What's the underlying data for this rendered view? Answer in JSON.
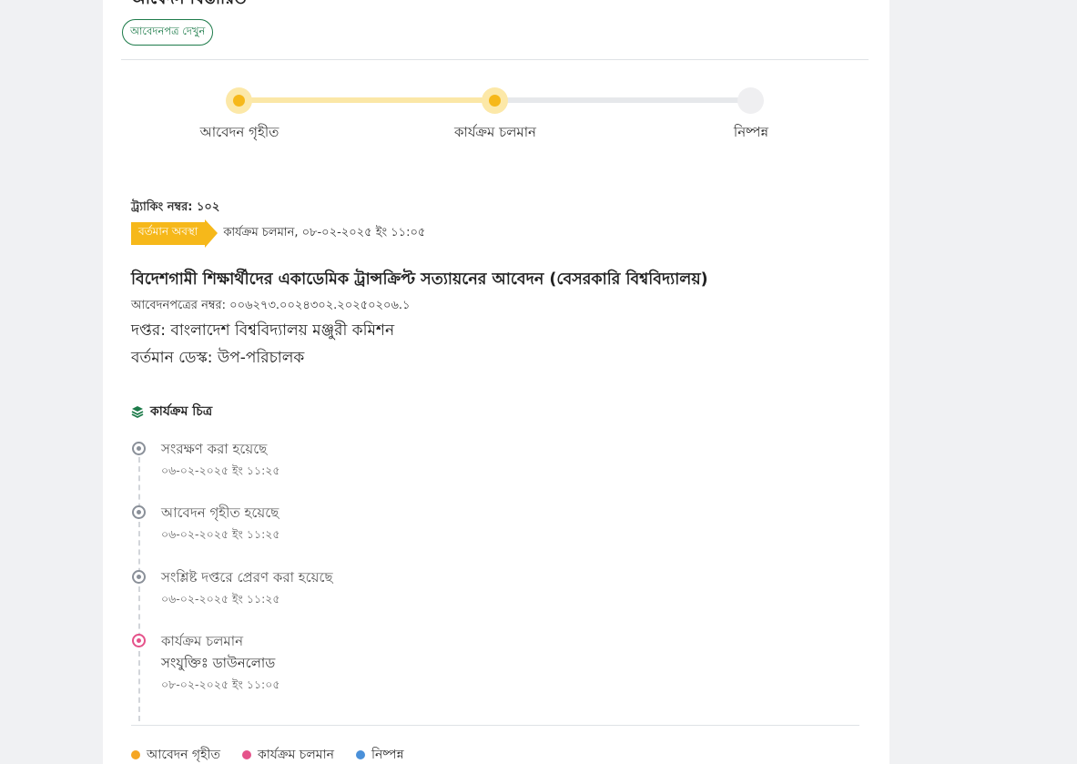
{
  "header": {
    "title_partial": "আবেদন বিস্তারিত",
    "view_button": "আবেদনপত্র দেখুন"
  },
  "progress": {
    "steps": [
      {
        "label": "আবেদন গৃহীত",
        "state": "done"
      },
      {
        "label": "কার্যক্রম চলমান",
        "state": "current"
      },
      {
        "label": "নিষ্পন্ন",
        "state": "pending"
      }
    ],
    "completed_fraction": 0.5
  },
  "status": {
    "tracking": "ট্র্যাকিং নম্বর: ১০২",
    "tag": "বর্তমান অবস্থা",
    "text": "কার্যক্রম চলমান, ০৮-০২-২০২৫ ইং ১১:০৫"
  },
  "application": {
    "title": "বিদেশগামী শিক্ষার্থীদের একাডেমিক ট্রান্সক্রিপ্ট সত্যায়নের আবেদন (বেসরকারি বিশ্ববিদ্যালয়)",
    "number": "আবেদনপত্রের নম্বর: ০০৬২৭৩.০০২৪৩০২.২০২৫০২০৬.১",
    "office": "দপ্তর: বাংলাদেশ বিশ্ববিদ্যালয় মঞ্জুরী কমিশন",
    "desk": "বর্তমান ডেস্ক: উপ-পরিচালক"
  },
  "timeline": {
    "heading": "কার্যক্রম চিত্র",
    "events": [
      {
        "title": "সংরক্ষণ করা হয়েছে",
        "time": "০৬-০২-২০২৫ ইং ১১:২৫"
      },
      {
        "title": "আবেদন গৃহীত হয়েছে",
        "time": "০৬-০২-২০২৫ ইং ১১:২৫"
      },
      {
        "title": "সংশ্লিষ্ট দপ্তরে প্রেরণ করা হয়েছে",
        "time": "০৬-০২-২০২৫ ইং ১১:২৫"
      },
      {
        "title": "কার্যক্রম চলমান",
        "attachment": "সংযুক্তিঃ ডাউনলোড",
        "time": "০৮-০২-২০২৫ ইং ১১:০৫"
      }
    ]
  },
  "legend": [
    {
      "label": "আবেদন গৃহীত",
      "color": "#f5a623"
    },
    {
      "label": "কার্যক্রম চলমান",
      "color": "#e5528a"
    },
    {
      "label": "নিষ্পন্ন",
      "color": "#4a90d9"
    }
  ],
  "colors": {
    "accent": "#f6b81a",
    "brand_green": "#1d7b4a",
    "active_event": "#e5528a",
    "past_event": "#8a9099"
  }
}
